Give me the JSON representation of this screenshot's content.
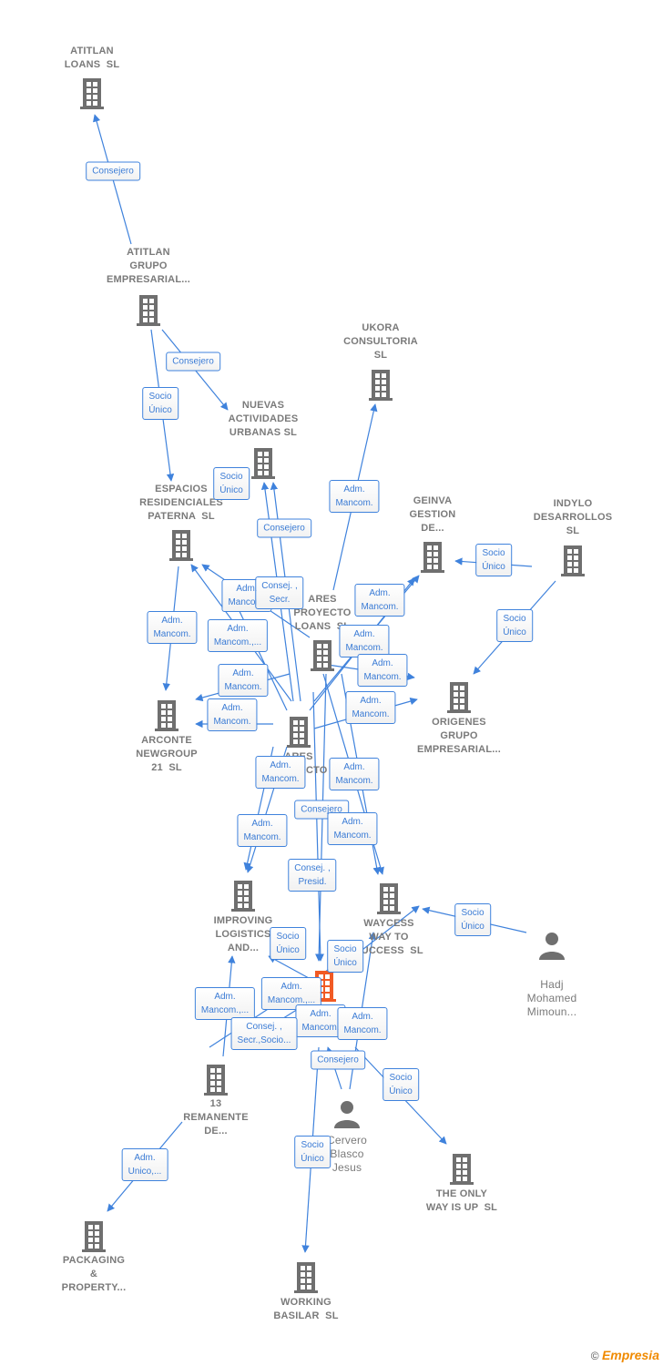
{
  "colors": {
    "edge": "#3f82dc",
    "node_icon": "#6f6f6f",
    "focus_node": "#f15a24",
    "label_text": "#7a7a7a"
  },
  "nodes": [
    {
      "id": "atitlan_loans",
      "type": "company",
      "label": "ATITLAN\nLOANS  SL"
    },
    {
      "id": "atitlan_grupo",
      "type": "company",
      "label": "ATITLAN\nGRUPO\nEMPRESARIAL..."
    },
    {
      "id": "ukora",
      "type": "company",
      "label": "UKORA\nCONSULTORIA\nSL"
    },
    {
      "id": "nuevas",
      "type": "company",
      "label": "NUEVAS\nACTIVIDADES\nURBANAS SL"
    },
    {
      "id": "espacios",
      "type": "company",
      "label": "ESPACIOS\nRESIDENCIALES\nPATERNA  SL"
    },
    {
      "id": "geinva",
      "type": "company",
      "label": "GEINVA\nGESTION\nDE..."
    },
    {
      "id": "indylo",
      "type": "company",
      "label": "INDYLO\nDESARROLLOS\nSL"
    },
    {
      "id": "ares_loans",
      "type": "company",
      "label": "ARES\nPROYECTO\nLOANS  SL"
    },
    {
      "id": "origenes",
      "type": "company",
      "label": "ORIGENES\nGRUPO\nEMPRESARIAL..."
    },
    {
      "id": "arconte",
      "type": "company",
      "label": "ARCONTE\nNEWGROUP\n21  SL"
    },
    {
      "id": "ares_2",
      "type": "company",
      "label": "ARES\nPROYECTO\nSL"
    },
    {
      "id": "improving",
      "type": "company",
      "label": "IMPROVING\nLOGISTICS\nAND..."
    },
    {
      "id": "waycess",
      "type": "company",
      "label": "WAYCESS\nWAY TO\nSUCCESS  SL"
    },
    {
      "id": "hadj",
      "type": "person",
      "label": "Hadj\nMohamed\nMimoun..."
    },
    {
      "id": "focus",
      "type": "company_focus",
      "label": ""
    },
    {
      "id": "remanente",
      "type": "company",
      "label": "13\nREMANENTE\nDE..."
    },
    {
      "id": "cervero",
      "type": "person",
      "label": "Cervero\nBlasco\nJesus"
    },
    {
      "id": "theonly",
      "type": "company",
      "label": "THE ONLY\nWAY IS UP  SL"
    },
    {
      "id": "packaging",
      "type": "company",
      "label": "PACKAGING\n&\nPROPERTY..."
    },
    {
      "id": "working",
      "type": "company",
      "label": "WORKING\nBASILAR  SL"
    }
  ],
  "edge_labels": [
    "Consejero",
    "Consejero",
    "Socio\nÚnico",
    "Socio\nÚnico",
    "Consejero",
    "Adm.\nMancom.",
    "Socio\nÚnico",
    "Socio\nÚnico",
    "Adm.\nMancom.",
    "Adm.\nMancom.",
    "Consej. ,\nSecr.",
    "Adm.\nMancom.,...",
    "Adm.\nMancom.",
    "Adm.\nMancom.",
    "Adm.\nMancom.",
    "Adm.\nMancom.",
    "Adm.\nMancom.",
    "Adm.\nMancom.",
    "Adm.\nMancom.",
    "Adm.\nMancom.",
    "Consejero",
    "Adm.\nMancom.",
    "Adm.\nMancom.",
    "Consej. ,\nPresid.",
    "Socio\nÚnico",
    "Socio\nÚnico",
    "Socio\nÚnico",
    "Adm.\nMancom.,...",
    "Adm.\nMancom.,...",
    "Adm.\nMancom.",
    "Consej. ,\nSecr.,Socio...",
    "Adm.\nMancom.",
    "Consejero",
    "Socio\nÚnico",
    "Socio\nÚnico",
    "Adm.\nUnico,..."
  ],
  "footer": {
    "copyright": "©",
    "brand": "Empresia"
  }
}
